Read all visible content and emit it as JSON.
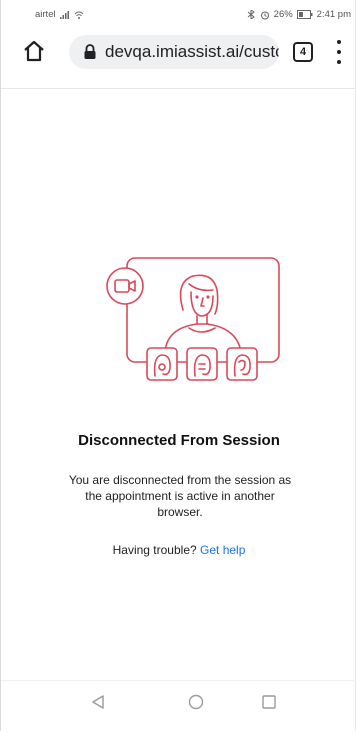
{
  "status_bar": {
    "carrier": "airtel",
    "battery_percent": "26%",
    "time": "2:41 pm"
  },
  "browser": {
    "url": "devqa.imiassist.ai/custc",
    "tab_count": "4",
    "icons": [
      "home-icon",
      "lock-icon",
      "tabs-icon",
      "more-vert-icon"
    ]
  },
  "main": {
    "title": "Disconnected From Session",
    "message": "You are disconnected from the session as the appointment is active in another browser.",
    "help_prompt": "Having trouble?",
    "help_link": "Get help",
    "illustration_icons": [
      "video-call-illustration",
      "video-camera-icon",
      "person-avatar",
      "participant-thumbnail"
    ]
  },
  "nav_bar": {
    "icons": [
      "back-triangle-icon",
      "home-circle-icon",
      "recents-square-icon"
    ]
  },
  "colors": {
    "accent": "#d9495a",
    "link": "#1a73e8",
    "url_pill": "#eef0f2"
  }
}
